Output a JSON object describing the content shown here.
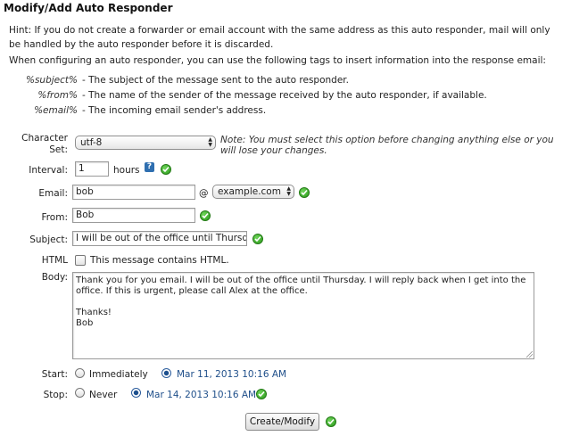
{
  "title": "Modify/Add Auto Responder",
  "hint": "Hint: If you do not create a forwarder or email account with the same address as this auto responder, mail will only be handled by the auto responder before it is discarded.",
  "lead": "When configuring an auto responder, you can use the following tags to insert information into the response email:",
  "tags": [
    {
      "tag": "%subject%",
      "desc": "- The subject of the message sent to the auto responder."
    },
    {
      "tag": "%from%",
      "desc": "- The name of the sender of the message received by the auto responder, if available."
    },
    {
      "tag": "%email%",
      "desc": "- The incoming email sender's address."
    }
  ],
  "charset": {
    "label_line1": "Character",
    "label_line2": "Set:",
    "value": "utf-8",
    "note": "Note: You must select this option before changing anything else or you will lose your changes."
  },
  "interval": {
    "label": "Interval:",
    "value": "1",
    "unit": "hours",
    "help": "?"
  },
  "email": {
    "label": "Email:",
    "value": "bob",
    "at": "@",
    "domain": "example.com"
  },
  "from": {
    "label": "From:",
    "value": "Bob"
  },
  "subject": {
    "label": "Subject:",
    "value": "I will be out of the office until Thursday"
  },
  "html": {
    "label": "HTML",
    "checkbox_label": "This message contains HTML."
  },
  "body": {
    "label": "Body:",
    "value": "Thank you for you email. I will be out of the office until Thursday. I will reply back when I get into the office. If this is urgent, please call Alex at the office.\n\nThanks!\nBob"
  },
  "start": {
    "label": "Start:",
    "option1": "Immediately",
    "option2": "Mar 11, 2013 10:16 AM",
    "selected": "option2"
  },
  "stop": {
    "label": "Stop:",
    "option1": "Never",
    "option2": "Mar 14, 2013 10:16 AM",
    "selected": "option2"
  },
  "submit_label": "Create/Modify",
  "colors": {
    "ok_green": "#2b9a1b",
    "link_blue": "#1f4f8a",
    "help_blue": "#2f6fb0"
  }
}
